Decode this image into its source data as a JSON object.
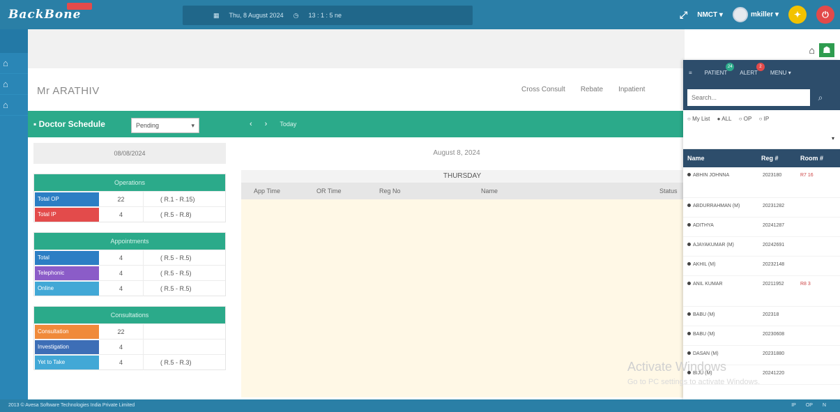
{
  "app": {
    "logo": "BackBone",
    "badge": ""
  },
  "topbar": {
    "date": "Thu, 8 August 2024",
    "time": "13 : 1 : 5 ne",
    "org": "NMCT",
    "user": "mkiller"
  },
  "header": {
    "patient_name": "Mr ARATHIV",
    "links": [
      "Cross Consult",
      "Rebate",
      "Inpatient"
    ]
  },
  "schedule": {
    "title": "Doctor Schedule",
    "status_value": "Pending",
    "today_label": "Today"
  },
  "left_panel": {
    "date": "08/08/2024",
    "blocks": [
      {
        "title": "Operations",
        "rows": [
          {
            "label": "Total OP",
            "count": "22",
            "range": "( R.1 - R.15)",
            "color": "#2c7ec4"
          },
          {
            "label": "Total IP",
            "count": "4",
            "range": "( R.5 - R.8)",
            "color": "#e34b4b"
          }
        ]
      },
      {
        "title": "Appointments",
        "rows": [
          {
            "label": "Total",
            "count": "4",
            "range": "( R.5 - R.5)",
            "color": "#2c7ec4"
          },
          {
            "label": "Telephonic",
            "count": "4",
            "range": "( R.5 - R.5)",
            "color": "#8b5cc8"
          },
          {
            "label": "Online",
            "count": "4",
            "range": "( R.5 - R.5)",
            "color": "#42a8d6"
          }
        ]
      },
      {
        "title": "Consultations",
        "rows": [
          {
            "label": "Consultation",
            "count": "22",
            "range": "",
            "color": "#f08a3a"
          },
          {
            "label": "Investigation",
            "count": "4",
            "range": "",
            "color": "#3d6eb6"
          },
          {
            "label": "Yet to Take",
            "count": "4",
            "range": "( R.5 - R.3)",
            "color": "#42a8d6"
          }
        ]
      }
    ]
  },
  "main": {
    "date_header": "August 8, 2024",
    "day": "THURSDAY",
    "columns": [
      "App Time",
      "OR Time",
      "Reg No",
      "Name",
      "Status"
    ]
  },
  "right_panel": {
    "tabs": [
      {
        "label": "PATIENT",
        "badge": "24",
        "badge_color": "#2baa8a"
      },
      {
        "label": "ALERT",
        "badge": "2",
        "badge_color": "#e34b4b"
      },
      {
        "label": "MENU",
        "badge": "",
        "badge_color": ""
      }
    ],
    "search_placeholder": "Search...",
    "filters": [
      "My List",
      "ALL",
      "OP",
      "IP"
    ],
    "table_headers": [
      "Name",
      "Reg #",
      "Room #"
    ],
    "patients": [
      {
        "name": "ABHIN JOHNNA",
        "reg": "2023180",
        "room": "R7 16"
      },
      {
        "name": "ABDURRAHMAN (M)",
        "reg": "20231282",
        "room": ""
      },
      {
        "name": "ADITHYA",
        "reg": "20241287",
        "room": ""
      },
      {
        "name": "AJAYAKUMAR (M)",
        "reg": "20242691",
        "room": ""
      },
      {
        "name": "AKHIL (M)",
        "reg": "20232148",
        "room": ""
      },
      {
        "name": "ANIL KUMAR",
        "reg": "20211952",
        "room": "R8 3"
      },
      {
        "name": "BABU (M)",
        "reg": "202318",
        "room": ""
      },
      {
        "name": "BABU (M)",
        "reg": "20230608",
        "room": ""
      },
      {
        "name": "DASAN (M)",
        "reg": "20231880",
        "room": ""
      },
      {
        "name": "BIJU (M)",
        "reg": "20241220",
        "room": ""
      }
    ]
  },
  "watermark": {
    "line1": "Activate Windows",
    "line2": "Go to PC settings to activate Windows."
  },
  "footer": {
    "copyright": "2013 © Avesa Software Technologies India Private Limited",
    "right": [
      "IP",
      "OP",
      "N"
    ]
  }
}
